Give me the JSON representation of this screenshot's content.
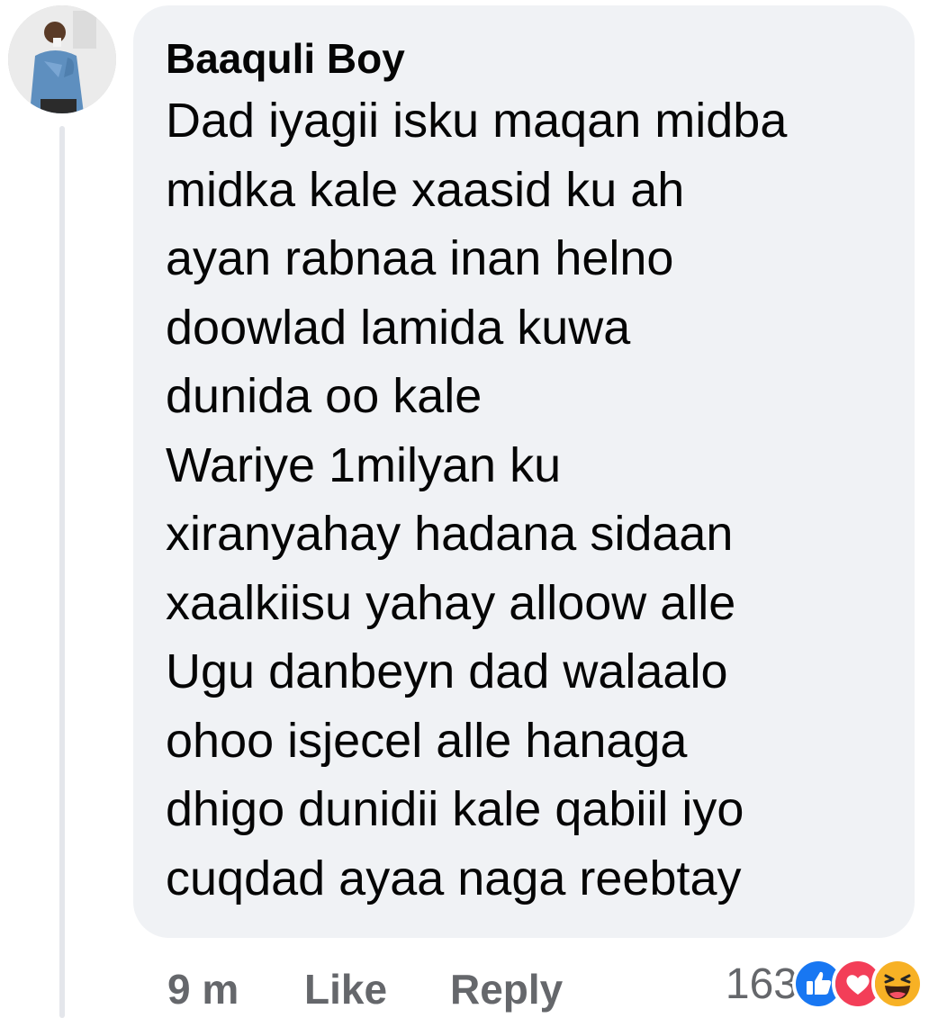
{
  "comment": {
    "author": "Baaquli Boy",
    "lines": [
      "Dad iyagii isku maqan midba",
      "midka kale xaasid ku ah",
      "ayan rabnaa inan helno",
      "doowlad lamida kuwa",
      "dunida oo kale",
      "Wariye 1milyan ku",
      "xiranyahay hadana sidaan",
      "xaalkiisu yahay alloow alle",
      "Ugu danbeyn dad walaalo",
      "ohoo isjecel alle hanaga",
      "dhigo dunidii kale qabiil iyo",
      "cuqdad ayaa naga reebtay"
    ]
  },
  "footer": {
    "time": "9 m",
    "like_label": "Like",
    "reply_label": "Reply",
    "reaction_count": "163",
    "reaction_icons": [
      "like-icon",
      "love-icon",
      "haha-icon"
    ]
  },
  "colors": {
    "bubble": "#f0f2f5",
    "text": "#050505",
    "meta": "#65676b",
    "like_blue": "#1877f2",
    "love_red": "#f33e58",
    "haha_yellow": "#f7b125"
  }
}
